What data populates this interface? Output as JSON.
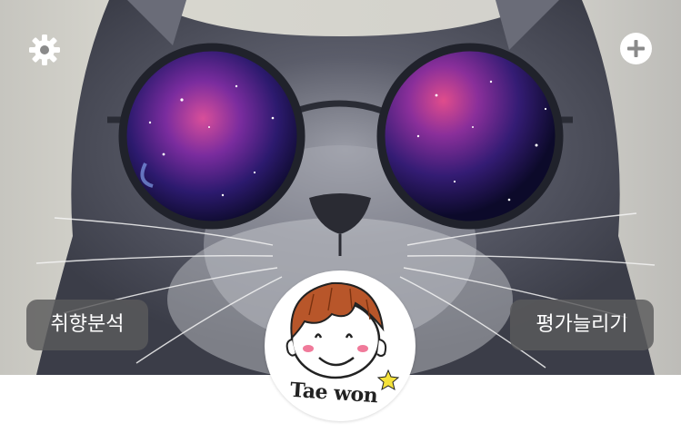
{
  "toolbar": {
    "settings_icon": "gear-icon",
    "add_icon": "plus-circle-icon"
  },
  "profile": {
    "taste_analysis_label": "취향분석",
    "more_ratings_label": "평가늘리기",
    "avatar_signature": "Tae won"
  },
  "colors": {
    "pill_background": "#5a5a5c",
    "pill_text": "#ffffff",
    "icon_color": "#ffffff",
    "page_background": "#ffffff"
  }
}
